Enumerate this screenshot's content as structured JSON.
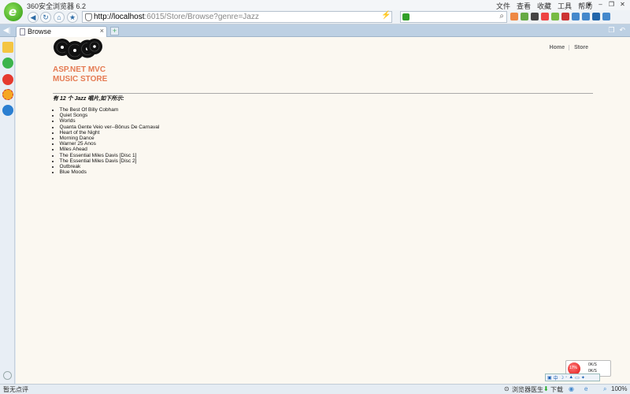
{
  "window": {
    "title": "360安全浏览器 6.2",
    "menu": [
      "文件",
      "查看",
      "收藏",
      "工具",
      "帮助"
    ],
    "controls": [
      "❦",
      "–",
      "❐",
      "✕"
    ]
  },
  "toolbar": {
    "address_host": "http://localhost",
    "address_rest": ":6015/Store/Browse?genre=Jazz",
    "search_value": ""
  },
  "tabs": [
    {
      "label": "Browse",
      "close": "×"
    }
  ],
  "new_tab": "+",
  "page": {
    "store_title_line1": "ASP.NET MVC",
    "store_title_line2": "MUSIC STORE",
    "nav": [
      "Home",
      "Store"
    ],
    "heading": "有 12 个 Jazz 唱片,如下所示:",
    "albums": [
      "The Best Of Billy Cobham",
      "Quiet Songs",
      "Worlds",
      "Quanta Gente Veio ver--Bônus De Carnaval",
      "Heart of the Night",
      "Morning Dance",
      "Warner 25 Anos",
      "Miles Ahead",
      "The Essential Miles Davis [Disc 1]",
      "The Essential Miles Davis [Disc 2]",
      "Outbreak",
      "Blue Moods"
    ]
  },
  "speed_widget": {
    "percent": "17%",
    "up": "0K/S",
    "down": "0K/S"
  },
  "status": {
    "left": "暂无点评",
    "doctor": "浏览器医生",
    "download": "下载",
    "zoom": "100%"
  },
  "colors": {
    "accent_title": "#e57b53",
    "content_bg": "#fbf8f1"
  }
}
